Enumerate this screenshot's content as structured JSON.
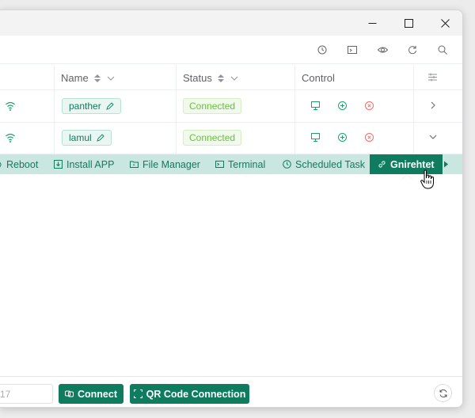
{
  "table": {
    "headers": {
      "name": "Name",
      "status": "Status",
      "control": "Control"
    },
    "rows": [
      {
        "name": "panther",
        "status": "Connected"
      },
      {
        "name": "lamul",
        "status": "Connected"
      }
    ]
  },
  "actions": {
    "reboot": "Reboot",
    "install_app": "Install APP",
    "file_manager": "File Manager",
    "terminal": "Terminal",
    "scheduled_task": "Scheduled Task",
    "active": "Gnirehtet"
  },
  "footer": {
    "ip_value": "17",
    "connect": "Connect",
    "qr_connect": "QR Code Connection"
  },
  "colors": {
    "brand": "#0f7b5f",
    "action_bar": "#c9e7df",
    "status_green": "#67c23a",
    "danger": "#f56c6c"
  },
  "icons": [
    "history-icon",
    "terminal-icon",
    "eye-icon",
    "refresh-icon",
    "search-icon",
    "wifi-icon",
    "monitor-icon",
    "plus-circle-icon",
    "close-circle-icon",
    "link-icon",
    "qr-icon"
  ]
}
